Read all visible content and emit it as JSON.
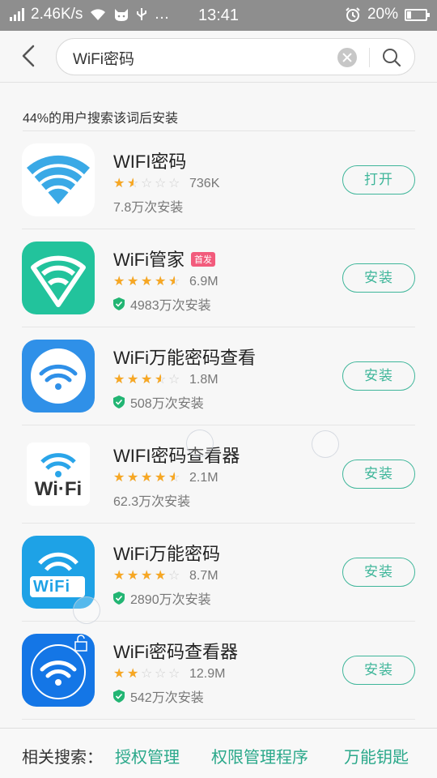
{
  "status_bar": {
    "speed": "2.46K/s",
    "misc": "…",
    "time": "13:41",
    "battery": "20%"
  },
  "search": {
    "query": "WiFi密码",
    "placeholder": ""
  },
  "hint": "44%的用户搜索该词后安装",
  "apps": [
    {
      "name": "WIFI密码",
      "badge": "",
      "rating": 1.5,
      "size": "736K",
      "installs": "7.8万次安装",
      "verified": false,
      "button": "打开",
      "icon": "wifi-plain-icon"
    },
    {
      "name": "WiFi管家",
      "badge": "首发",
      "rating": 4.5,
      "size": "6.9M",
      "installs": "4983万次安装",
      "verified": true,
      "button": "安装",
      "icon": "wifi-shield-icon"
    },
    {
      "name": "WiFi万能密码查看",
      "badge": "",
      "rating": 3.5,
      "size": "1.8M",
      "installs": "508万次安装",
      "verified": true,
      "button": "安装",
      "icon": "wifi-circle-icon"
    },
    {
      "name": "WIFI密码查看器",
      "badge": "",
      "rating": 4.5,
      "size": "2.1M",
      "installs": "62.3万次安装",
      "verified": false,
      "button": "安装",
      "icon": "wifi-text-icon",
      "icon_text": "Wi·Fi"
    },
    {
      "name": "WiFi万能密码",
      "badge": "",
      "rating": 4,
      "size": "8.7M",
      "installs": "2890万次安装",
      "verified": true,
      "button": "安装",
      "icon": "wifi-key-icon",
      "icon_text": "WiFi"
    },
    {
      "name": "WiFi密码查看器",
      "badge": "",
      "rating": 2,
      "size": "12.9M",
      "installs": "542万次安装",
      "verified": true,
      "button": "安装",
      "icon": "wifi-lock-icon"
    }
  ],
  "related": {
    "label": "相关搜索：",
    "keywords": [
      "授权管理",
      "权限管理程序",
      "万能钥匙"
    ]
  },
  "colors": {
    "accent": "#3fb69a",
    "star": "#f7a723",
    "badge": "#f25b7c",
    "status_bar": "#8e8e8e"
  }
}
